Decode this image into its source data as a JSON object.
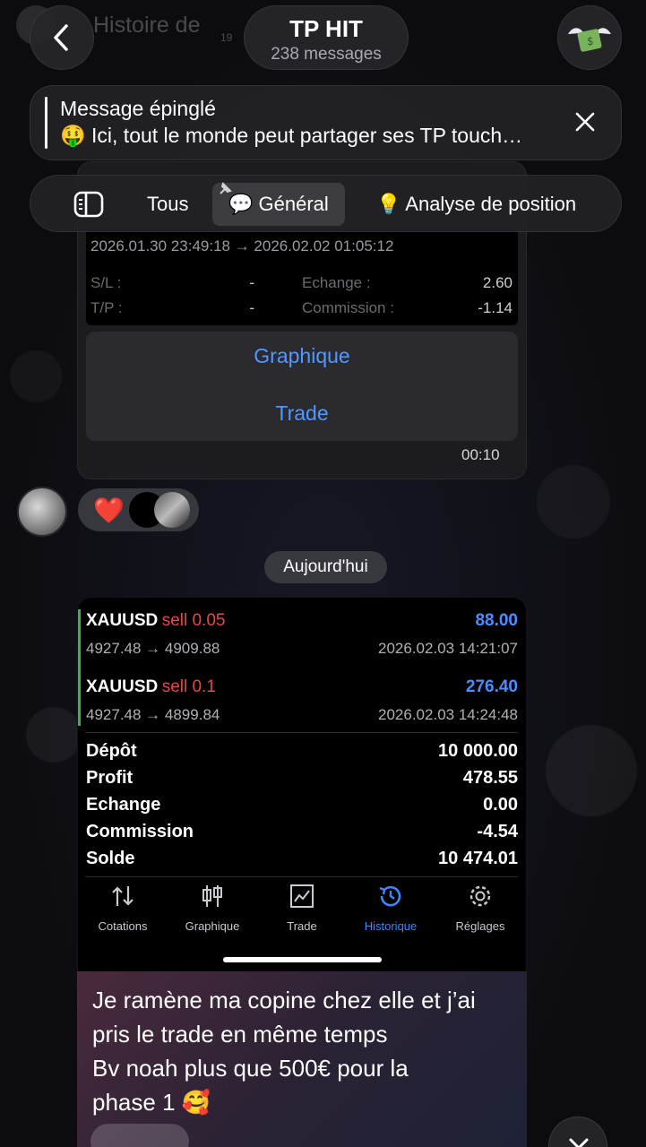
{
  "header": {
    "faded_title": "Histoire de",
    "faded_time": "19",
    "title": "TP HIT",
    "subtitle": "238 messages"
  },
  "pinned": {
    "label": "Message épinglé",
    "text": "🤑 Ici, tout le monde peut partager ses TP touch…"
  },
  "tabs": {
    "all": "Tous",
    "general": "💬 Général",
    "analysis": "💡 Analyse de position"
  },
  "ticket": {
    "dates": "2026.01.30 23:49:18 → 2026.02.02 01:05:12",
    "sl_label": "S/L :",
    "sl_value": "-",
    "tp_label": "T/P :",
    "tp_value": "-",
    "swap_label": "Echange :",
    "swap_value": "2.60",
    "comm_label": "Commission :",
    "comm_value": "-1.14"
  },
  "context_menu": {
    "chart": "Graphique",
    "trade": "Trade"
  },
  "message1_time": "00:10",
  "reactions": {
    "heart": "❤️"
  },
  "date_separator": "Aujourd'hui",
  "trades": [
    {
      "symbol": "XAUUSD",
      "side": "sell 0.05",
      "profit": "88.00",
      "prices": "4927.48 → 4909.88",
      "time": "2026.02.03 14:21:07"
    },
    {
      "symbol": "XAUUSD",
      "side": "sell 0.1",
      "profit": "276.40",
      "prices": "4927.48 → 4899.84",
      "time": "2026.02.03 14:24:48"
    }
  ],
  "summary": [
    {
      "label": "Dépôt",
      "value": "10 000.00"
    },
    {
      "label": "Profit",
      "value": "478.55"
    },
    {
      "label": "Echange",
      "value": "0.00"
    },
    {
      "label": "Commission",
      "value": "-4.54"
    },
    {
      "label": "Solde",
      "value": "10 474.01"
    }
  ],
  "app_nav": {
    "quotes": "Cotations",
    "chart": "Graphique",
    "trade": "Trade",
    "history": "Historique",
    "settings": "Réglages"
  },
  "caption": {
    "line1": "Je ramène ma copine chez elle et j’ai",
    "line2": "pris le trade en même temps",
    "line3": "Bv noah plus que 500€ pour la",
    "line4": "phase 1 🥰"
  },
  "colors": {
    "accent_blue": "#4f98ff",
    "sell_red": "#e54848",
    "profit_blue": "#4f8cff",
    "trade_bar_green": "#3cb04a"
  }
}
